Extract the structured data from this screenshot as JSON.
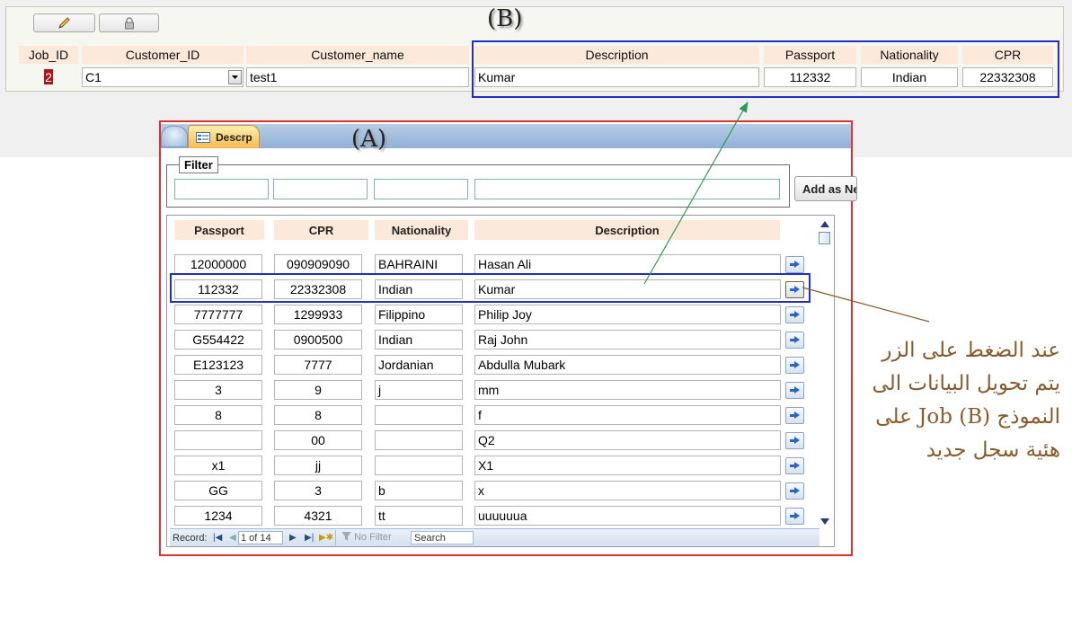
{
  "form_b": {
    "label": "(B)",
    "toolbar": {
      "edit_icon": "pencil-icon",
      "lock_icon": "lock-icon"
    },
    "headers": [
      "Job_ID",
      "Customer_ID",
      "Customer_name",
      "Description",
      "Passport",
      "Nationality",
      "CPR"
    ],
    "record": {
      "job_id": "2",
      "customer_id": "C1",
      "customer_name": "test1",
      "description": "Kumar",
      "passport": "112332",
      "nationality": "Indian",
      "cpr": "22332308"
    },
    "highlight_color": "#1f2fc8"
  },
  "form_a": {
    "label": "(A)",
    "tab_label": "Descrp",
    "filter_label": "Filter",
    "filter_values": [
      "",
      "",
      "",
      ""
    ],
    "add_button": "Add as New",
    "headers": [
      "Passport",
      "CPR",
      "Nationality",
      "Description"
    ],
    "rows": [
      [
        "12000000",
        "090909090",
        "BAHRAINI",
        "Hasan Ali"
      ],
      [
        "112332",
        "22332308",
        "Indian",
        "Kumar"
      ],
      [
        "7777777",
        "1299933",
        "Filippino",
        "Philip Joy"
      ],
      [
        "G554422",
        "0900500",
        "Indian",
        "Raj John"
      ],
      [
        "E123123",
        "7777",
        "Jordanian",
        "Abdulla Mubark"
      ],
      [
        "3",
        "9",
        "j",
        "mm"
      ],
      [
        "8",
        "8",
        "",
        "f"
      ],
      [
        "",
        "00",
        "",
        "Q2"
      ],
      [
        "x1",
        "jj",
        "",
        "X1"
      ],
      [
        "GG",
        "3",
        "b",
        "x"
      ],
      [
        "1234",
        "4321",
        "tt",
        "uuuuuua"
      ]
    ],
    "selected_row": 1,
    "navigator": {
      "record_label": "Record:",
      "position": "1 of 14",
      "filter_status": "No Filter",
      "search_placeholder": "Search"
    },
    "border_color": "#e23131"
  },
  "annotation": {
    "lines": [
      "عند الضغط على الزر",
      "يتم تحويل البيانات الى",
      "النموذج Job (B) على",
      "هئية سجل جديد"
    ],
    "text_color": "#8a5a2b",
    "arrow_color": "#2e9a5a"
  }
}
